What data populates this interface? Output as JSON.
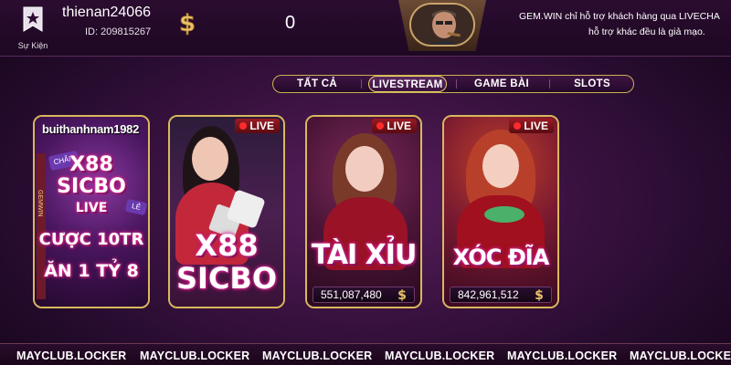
{
  "header": {
    "event_label": "Sự Kiện",
    "username": "thienan24066",
    "user_id": "ID: 209815267",
    "balance": "0",
    "notice_line1": "GEM.WIN chỉ hỗ trợ khách hàng qua LIVECHA",
    "notice_line2": "hỗ trợ khác đều là giả mạo."
  },
  "tabs": [
    {
      "label": "TẤT CẢ",
      "active": false
    },
    {
      "label": "LIVESTREAM",
      "active": true
    },
    {
      "label": "GAME BÀI",
      "active": false
    },
    {
      "label": "SLOTS",
      "active": false
    }
  ],
  "cards": [
    {
      "username": "buithanhnam1982",
      "logo_line1": "X88",
      "logo_line2": "SICBO",
      "logo_line3": "LIVE",
      "promo_line1": "CƯỢC 10TR",
      "promo_line2": "ĂN 1 TỶ 8",
      "side_text": "GEMWIN",
      "chan_label": "CHẴN",
      "le_label": "LẺ"
    },
    {
      "badge": "LIVE",
      "logo_line1": "X88",
      "logo_line2": "SICBO"
    },
    {
      "badge": "LIVE",
      "logo": "TÀI XỈU",
      "pot": "551,087,480"
    },
    {
      "badge": "LIVE",
      "logo": "XÓC ĐĨA",
      "pot": "842,961,512"
    }
  ],
  "watermark": [
    "MAYCLUB.LOCKER",
    "MAYCLUB.LOCKER",
    "MAYCLUB.LOCKER",
    "MAYCLUB.LOCKER",
    "MAYCLUB.LOCKER",
    "MAYCLUB.LOCKER"
  ],
  "colors": {
    "accent_gold": "#d9b85c",
    "live_red": "#9a1a24",
    "bg_purple": "#3a1240"
  }
}
